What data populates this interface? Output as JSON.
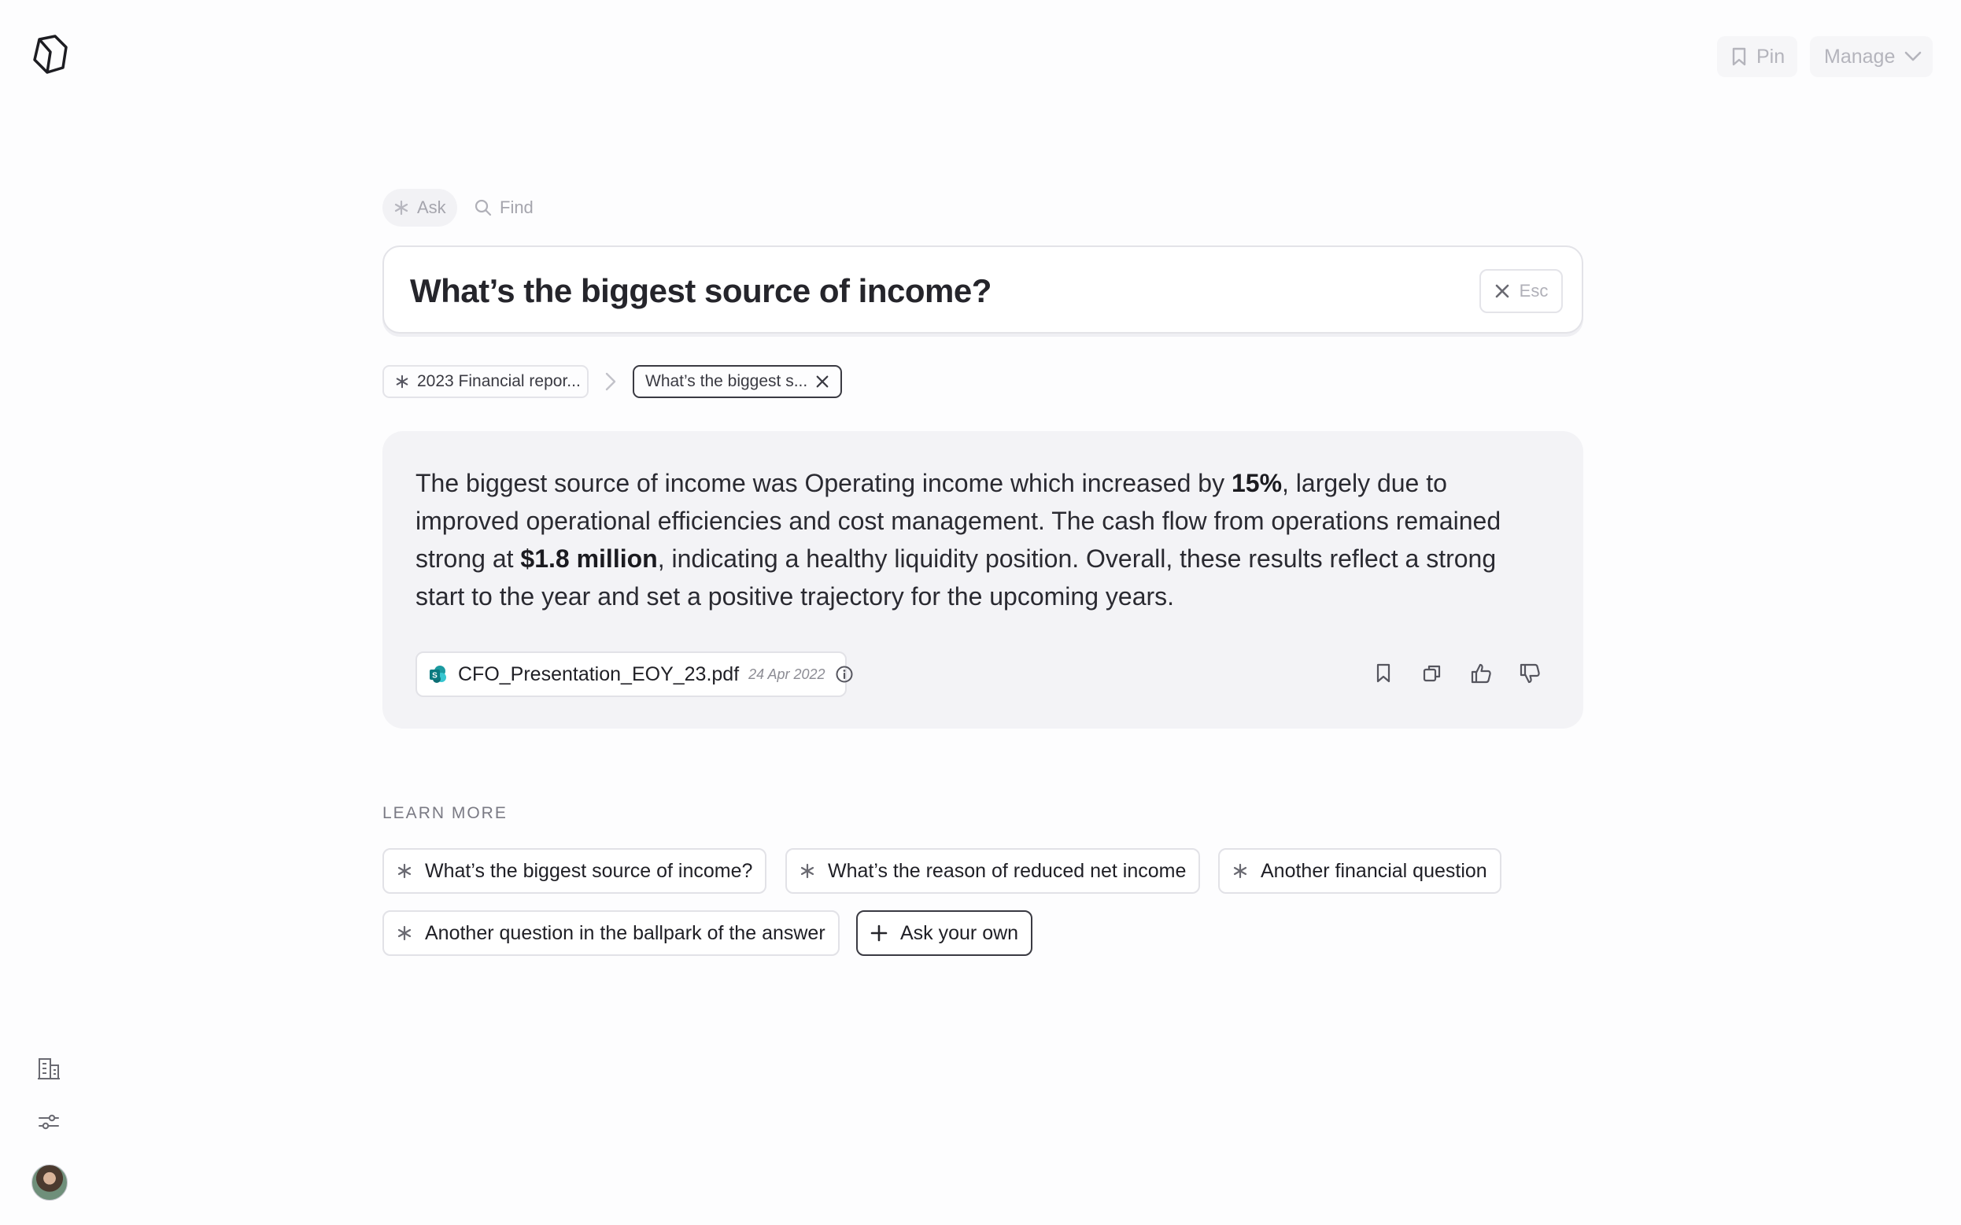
{
  "header": {
    "logo_icon": "hexagon-logo-icon",
    "pin_label": "Pin",
    "manage_label": "Manage"
  },
  "modes": {
    "ask_label": "Ask",
    "find_label": "Find"
  },
  "search": {
    "query": "What’s the biggest source of income?",
    "esc_label": "Esc"
  },
  "breadcrumb": {
    "items": [
      "2023 Financial repor...",
      "What’s the biggest s..."
    ]
  },
  "answer": {
    "part1": "The biggest source of income was Operating income which increased by ",
    "bold1": "15%",
    "part2": ", largely due to improved operational efficiencies and cost management. The cash flow from operations remained strong at ",
    "bold2": "$1.8 million",
    "part3": ", indicating a healthy liquidity position. Overall, these results reflect a strong start to the year and set a positive trajectory for the upcoming years.",
    "source": {
      "name": "CFO_Presentation_EOY_23.pdf",
      "date": "24 Apr 2022"
    }
  },
  "learn_more": {
    "title": "LEARN MORE",
    "suggestions": [
      "What’s the biggest source of income?",
      "What’s the reason of reduced net income",
      "Another financial question",
      "Another question in the ballpark of the answer"
    ],
    "ask_own_label": "Ask your own"
  },
  "colors": {
    "background": "#fdfdfe",
    "card": "#f3f3f6",
    "text": "#1d1d22",
    "muted": "#a5a5ad",
    "source_icon": "#1a8a8a"
  }
}
